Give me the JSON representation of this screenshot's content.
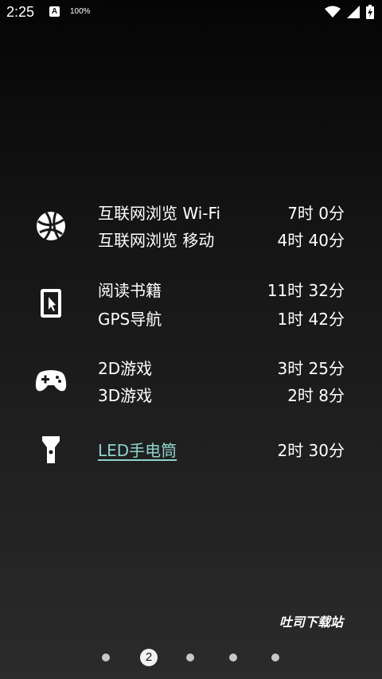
{
  "status_bar": {
    "time": "2:25",
    "notification_icon": "a-icon",
    "notification_letter": "A",
    "battery_percent": "100%",
    "right_icons": [
      "wifi-icon",
      "signal-icon",
      "battery-charging-icon"
    ]
  },
  "usage": {
    "groups": [
      {
        "icon": "globe-icon",
        "items": [
          {
            "label": "互联网浏览 Wi-Fi",
            "value": "7时 0分"
          },
          {
            "label": "互联网浏览 移动",
            "value": "4时 40分"
          }
        ]
      },
      {
        "icon": "tablet-touch-icon",
        "items": [
          {
            "label": "阅读书籍",
            "value": "11时 32分"
          },
          {
            "label": "GPS导航",
            "value": "1时 42分"
          }
        ]
      },
      {
        "icon": "gamepad-icon",
        "items": [
          {
            "label": "2D游戏",
            "value": "3时 25分"
          },
          {
            "label": "3D游戏",
            "value": "2时 8分"
          }
        ]
      },
      {
        "icon": "flashlight-icon",
        "items": [
          {
            "label": "LED手电筒",
            "value": "2时 30分"
          }
        ]
      }
    ]
  },
  "watermark": "吐司下载站",
  "pager": {
    "current_page": "2",
    "total_pages": 5
  },
  "colors": {
    "link": "#8fd3cd",
    "text": "#ffffff"
  }
}
